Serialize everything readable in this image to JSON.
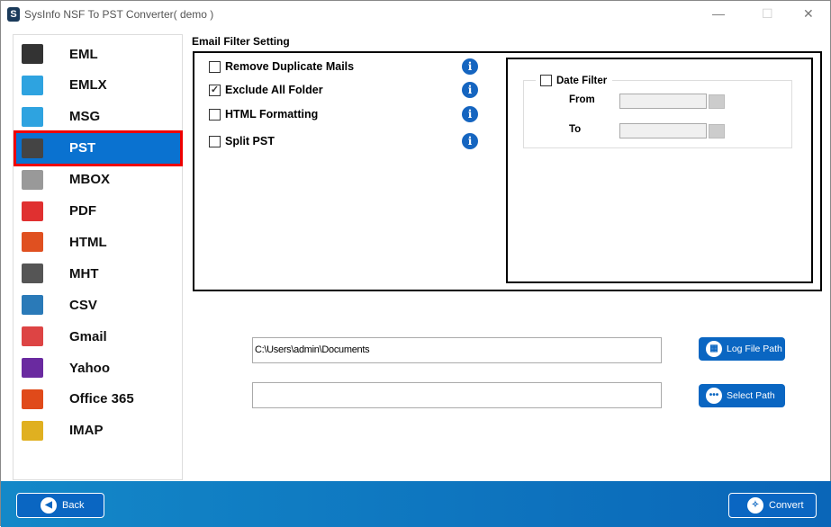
{
  "window": {
    "title": "SysInfo NSF To PST Converter( demo )",
    "logo": "S"
  },
  "sidebar": {
    "items": [
      {
        "label": "EML",
        "icon": "eml-icon",
        "color": "#333"
      },
      {
        "label": "EMLX",
        "icon": "emlx-icon",
        "color": "#2ea3e0"
      },
      {
        "label": "MSG",
        "icon": "msg-icon",
        "color": "#2ea3e0"
      },
      {
        "label": "PST",
        "icon": "pst-icon",
        "color": "#444"
      },
      {
        "label": "MBOX",
        "icon": "mbox-icon",
        "color": "#999"
      },
      {
        "label": "PDF",
        "icon": "pdf-icon",
        "color": "#e03030"
      },
      {
        "label": "HTML",
        "icon": "html-icon",
        "color": "#e05020"
      },
      {
        "label": "MHT",
        "icon": "mht-icon",
        "color": "#555"
      },
      {
        "label": "CSV",
        "icon": "csv-icon",
        "color": "#2a7ab8"
      },
      {
        "label": "Gmail",
        "icon": "gmail-icon",
        "color": "#d44"
      },
      {
        "label": "Yahoo",
        "icon": "yahoo-icon",
        "color": "#6a2aa0"
      },
      {
        "label": "Office 365",
        "icon": "office365-icon",
        "color": "#e04a1a"
      },
      {
        "label": "IMAP",
        "icon": "imap-icon",
        "color": "#e0b020"
      }
    ],
    "selected": "PST"
  },
  "filter": {
    "title": "Email Filter Setting",
    "options": [
      {
        "label": "Remove Duplicate Mails",
        "checked": false
      },
      {
        "label": "Exclude All Folder",
        "checked": true
      },
      {
        "label": "HTML Formatting",
        "checked": false
      },
      {
        "label": "Split PST",
        "checked": false
      }
    ],
    "date": {
      "label": "Date Filter",
      "checked": false,
      "from_label": "From",
      "to_label": "To",
      "from": "",
      "to": ""
    }
  },
  "paths": {
    "log_path": "C:\\Users\\admin\\Documents",
    "log_button": "Log File Path",
    "dest_path": "",
    "select_button": "Select Path"
  },
  "footer": {
    "back": "Back",
    "convert": "Convert"
  }
}
